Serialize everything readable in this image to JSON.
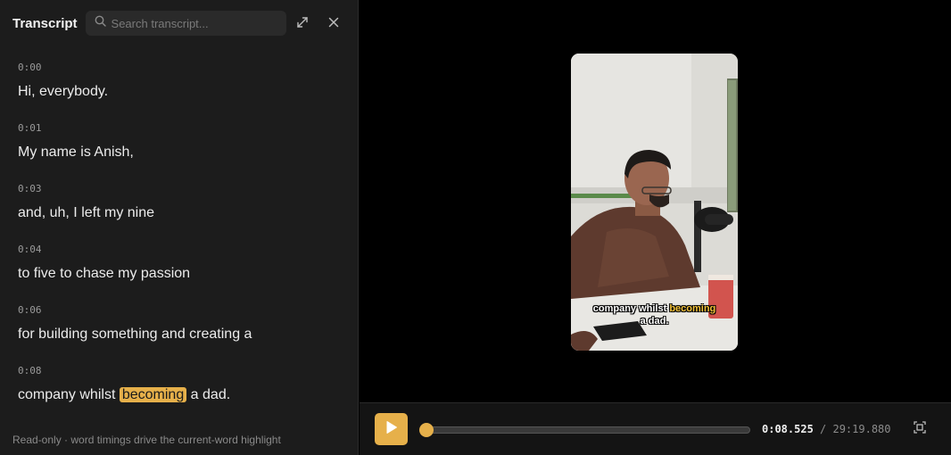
{
  "transcript": {
    "title": "Transcript",
    "search_placeholder": "Search transcript...",
    "segments": [
      {
        "time": "0:00",
        "words": [
          "Hi,",
          "everybody."
        ]
      },
      {
        "time": "0:01",
        "words": [
          "My",
          "name",
          "is",
          "Anish,"
        ]
      },
      {
        "time": "0:03",
        "words": [
          "and,",
          "uh,",
          "I",
          "left",
          "my",
          "nine"
        ]
      },
      {
        "time": "0:04",
        "words": [
          "to",
          "five",
          "to",
          "chase",
          "my",
          "passion"
        ]
      },
      {
        "time": "0:06",
        "words": [
          "for",
          "building",
          "something",
          "and",
          "creating",
          "a"
        ]
      },
      {
        "time": "0:08",
        "words": [
          "company",
          "whilst",
          "becoming",
          "a",
          "dad."
        ],
        "highlight_index": 2
      }
    ],
    "footer": "Read-only · word timings drive the current-word highlight"
  },
  "video": {
    "caption_before": "company whilst ",
    "caption_highlight": "becoming",
    "caption_after": "a dad."
  },
  "player": {
    "current_time": "0:08.525",
    "separator": " / ",
    "duration": "29:19.880",
    "progress_fraction": 0.0049
  },
  "colors": {
    "accent": "#e6b04a",
    "panel_bg": "#1c1c1c",
    "video_bg": "#000000",
    "caption_highlight": "#f2c23a"
  },
  "icons": {
    "search": "search-icon",
    "expand": "expand-icon",
    "close": "close-icon",
    "play": "play-icon",
    "snapshot": "screenshot-icon"
  }
}
